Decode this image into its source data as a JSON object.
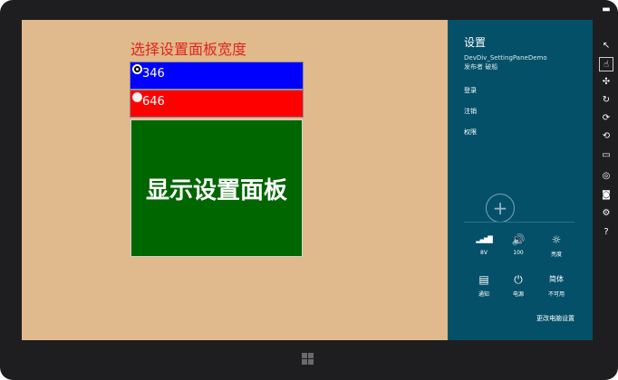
{
  "app": {
    "title": "选择设置面板宽度",
    "options": [
      {
        "value": "346",
        "selected": true,
        "color": "#0000ff"
      },
      {
        "value": "646",
        "selected": false,
        "color": "#ff0000"
      }
    ],
    "panel_button": "显示设置面板",
    "background_color": "#e0b98c",
    "panel_color": "#006600"
  },
  "charm": {
    "title": "设置",
    "app_name": "DevDiv_SettingPaneDemo",
    "publisher": "发布者 破船",
    "links": [
      "登录",
      "注销",
      "权限"
    ],
    "add_icon": "plus-circle-icon",
    "quick": [
      {
        "icon": "network-icon",
        "glyph": "▂▄▆█",
        "label": "8V"
      },
      {
        "icon": "volume-icon",
        "glyph": "🔊",
        "label": "100"
      },
      {
        "icon": "brightness-icon",
        "glyph": "☼",
        "label": "亮度"
      },
      {
        "icon": "notifications-icon",
        "glyph": "▤",
        "label": "通知"
      },
      {
        "icon": "power-icon",
        "glyph": "⏻",
        "label": "电源"
      },
      {
        "icon": "keyboard-icon",
        "glyph": "简体",
        "label": "不可用"
      }
    ],
    "change_settings": "更改电脑设置",
    "background_color": "#045069"
  },
  "sidebar": [
    {
      "icon": "minimize-icon",
      "glyph": "▬"
    },
    {
      "icon": "cursor-icon",
      "glyph": "↖"
    },
    {
      "icon": "touch-icon",
      "glyph": "☝",
      "active": true
    },
    {
      "icon": "pinch-icon",
      "glyph": "✣"
    },
    {
      "icon": "rotate-gesture-icon",
      "glyph": "↻"
    },
    {
      "icon": "rotate-clockwise-icon",
      "glyph": "⟳"
    },
    {
      "icon": "rotate-counterclockwise-icon",
      "glyph": "⟲"
    },
    {
      "icon": "resolution-icon",
      "glyph": "▭"
    },
    {
      "icon": "globe-icon",
      "glyph": "◎"
    },
    {
      "icon": "camera-icon",
      "glyph": "◙"
    },
    {
      "icon": "settings-icon",
      "glyph": "⚙"
    },
    {
      "icon": "help-icon",
      "glyph": "?"
    }
  ],
  "windows_button": {
    "icon": "windows-logo-icon"
  }
}
